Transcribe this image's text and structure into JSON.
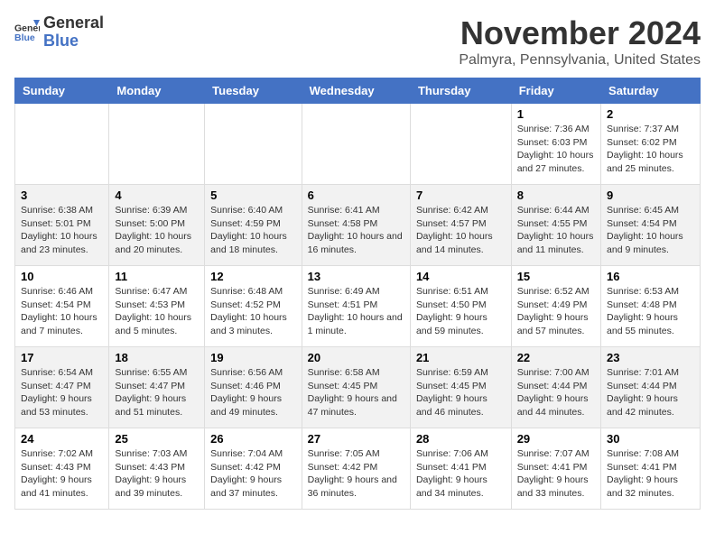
{
  "logo": {
    "line1": "General",
    "line2": "Blue"
  },
  "title": "November 2024",
  "location": "Palmyra, Pennsylvania, United States",
  "days_of_week": [
    "Sunday",
    "Monday",
    "Tuesday",
    "Wednesday",
    "Thursday",
    "Friday",
    "Saturday"
  ],
  "weeks": [
    [
      {
        "num": "",
        "info": ""
      },
      {
        "num": "",
        "info": ""
      },
      {
        "num": "",
        "info": ""
      },
      {
        "num": "",
        "info": ""
      },
      {
        "num": "",
        "info": ""
      },
      {
        "num": "1",
        "info": "Sunrise: 7:36 AM\nSunset: 6:03 PM\nDaylight: 10 hours and 27 minutes."
      },
      {
        "num": "2",
        "info": "Sunrise: 7:37 AM\nSunset: 6:02 PM\nDaylight: 10 hours and 25 minutes."
      }
    ],
    [
      {
        "num": "3",
        "info": "Sunrise: 6:38 AM\nSunset: 5:01 PM\nDaylight: 10 hours and 23 minutes."
      },
      {
        "num": "4",
        "info": "Sunrise: 6:39 AM\nSunset: 5:00 PM\nDaylight: 10 hours and 20 minutes."
      },
      {
        "num": "5",
        "info": "Sunrise: 6:40 AM\nSunset: 4:59 PM\nDaylight: 10 hours and 18 minutes."
      },
      {
        "num": "6",
        "info": "Sunrise: 6:41 AM\nSunset: 4:58 PM\nDaylight: 10 hours and 16 minutes."
      },
      {
        "num": "7",
        "info": "Sunrise: 6:42 AM\nSunset: 4:57 PM\nDaylight: 10 hours and 14 minutes."
      },
      {
        "num": "8",
        "info": "Sunrise: 6:44 AM\nSunset: 4:55 PM\nDaylight: 10 hours and 11 minutes."
      },
      {
        "num": "9",
        "info": "Sunrise: 6:45 AM\nSunset: 4:54 PM\nDaylight: 10 hours and 9 minutes."
      }
    ],
    [
      {
        "num": "10",
        "info": "Sunrise: 6:46 AM\nSunset: 4:54 PM\nDaylight: 10 hours and 7 minutes."
      },
      {
        "num": "11",
        "info": "Sunrise: 6:47 AM\nSunset: 4:53 PM\nDaylight: 10 hours and 5 minutes."
      },
      {
        "num": "12",
        "info": "Sunrise: 6:48 AM\nSunset: 4:52 PM\nDaylight: 10 hours and 3 minutes."
      },
      {
        "num": "13",
        "info": "Sunrise: 6:49 AM\nSunset: 4:51 PM\nDaylight: 10 hours and 1 minute."
      },
      {
        "num": "14",
        "info": "Sunrise: 6:51 AM\nSunset: 4:50 PM\nDaylight: 9 hours and 59 minutes."
      },
      {
        "num": "15",
        "info": "Sunrise: 6:52 AM\nSunset: 4:49 PM\nDaylight: 9 hours and 57 minutes."
      },
      {
        "num": "16",
        "info": "Sunrise: 6:53 AM\nSunset: 4:48 PM\nDaylight: 9 hours and 55 minutes."
      }
    ],
    [
      {
        "num": "17",
        "info": "Sunrise: 6:54 AM\nSunset: 4:47 PM\nDaylight: 9 hours and 53 minutes."
      },
      {
        "num": "18",
        "info": "Sunrise: 6:55 AM\nSunset: 4:47 PM\nDaylight: 9 hours and 51 minutes."
      },
      {
        "num": "19",
        "info": "Sunrise: 6:56 AM\nSunset: 4:46 PM\nDaylight: 9 hours and 49 minutes."
      },
      {
        "num": "20",
        "info": "Sunrise: 6:58 AM\nSunset: 4:45 PM\nDaylight: 9 hours and 47 minutes."
      },
      {
        "num": "21",
        "info": "Sunrise: 6:59 AM\nSunset: 4:45 PM\nDaylight: 9 hours and 46 minutes."
      },
      {
        "num": "22",
        "info": "Sunrise: 7:00 AM\nSunset: 4:44 PM\nDaylight: 9 hours and 44 minutes."
      },
      {
        "num": "23",
        "info": "Sunrise: 7:01 AM\nSunset: 4:44 PM\nDaylight: 9 hours and 42 minutes."
      }
    ],
    [
      {
        "num": "24",
        "info": "Sunrise: 7:02 AM\nSunset: 4:43 PM\nDaylight: 9 hours and 41 minutes."
      },
      {
        "num": "25",
        "info": "Sunrise: 7:03 AM\nSunset: 4:43 PM\nDaylight: 9 hours and 39 minutes."
      },
      {
        "num": "26",
        "info": "Sunrise: 7:04 AM\nSunset: 4:42 PM\nDaylight: 9 hours and 37 minutes."
      },
      {
        "num": "27",
        "info": "Sunrise: 7:05 AM\nSunset: 4:42 PM\nDaylight: 9 hours and 36 minutes."
      },
      {
        "num": "28",
        "info": "Sunrise: 7:06 AM\nSunset: 4:41 PM\nDaylight: 9 hours and 34 minutes."
      },
      {
        "num": "29",
        "info": "Sunrise: 7:07 AM\nSunset: 4:41 PM\nDaylight: 9 hours and 33 minutes."
      },
      {
        "num": "30",
        "info": "Sunrise: 7:08 AM\nSunset: 4:41 PM\nDaylight: 9 hours and 32 minutes."
      }
    ]
  ]
}
